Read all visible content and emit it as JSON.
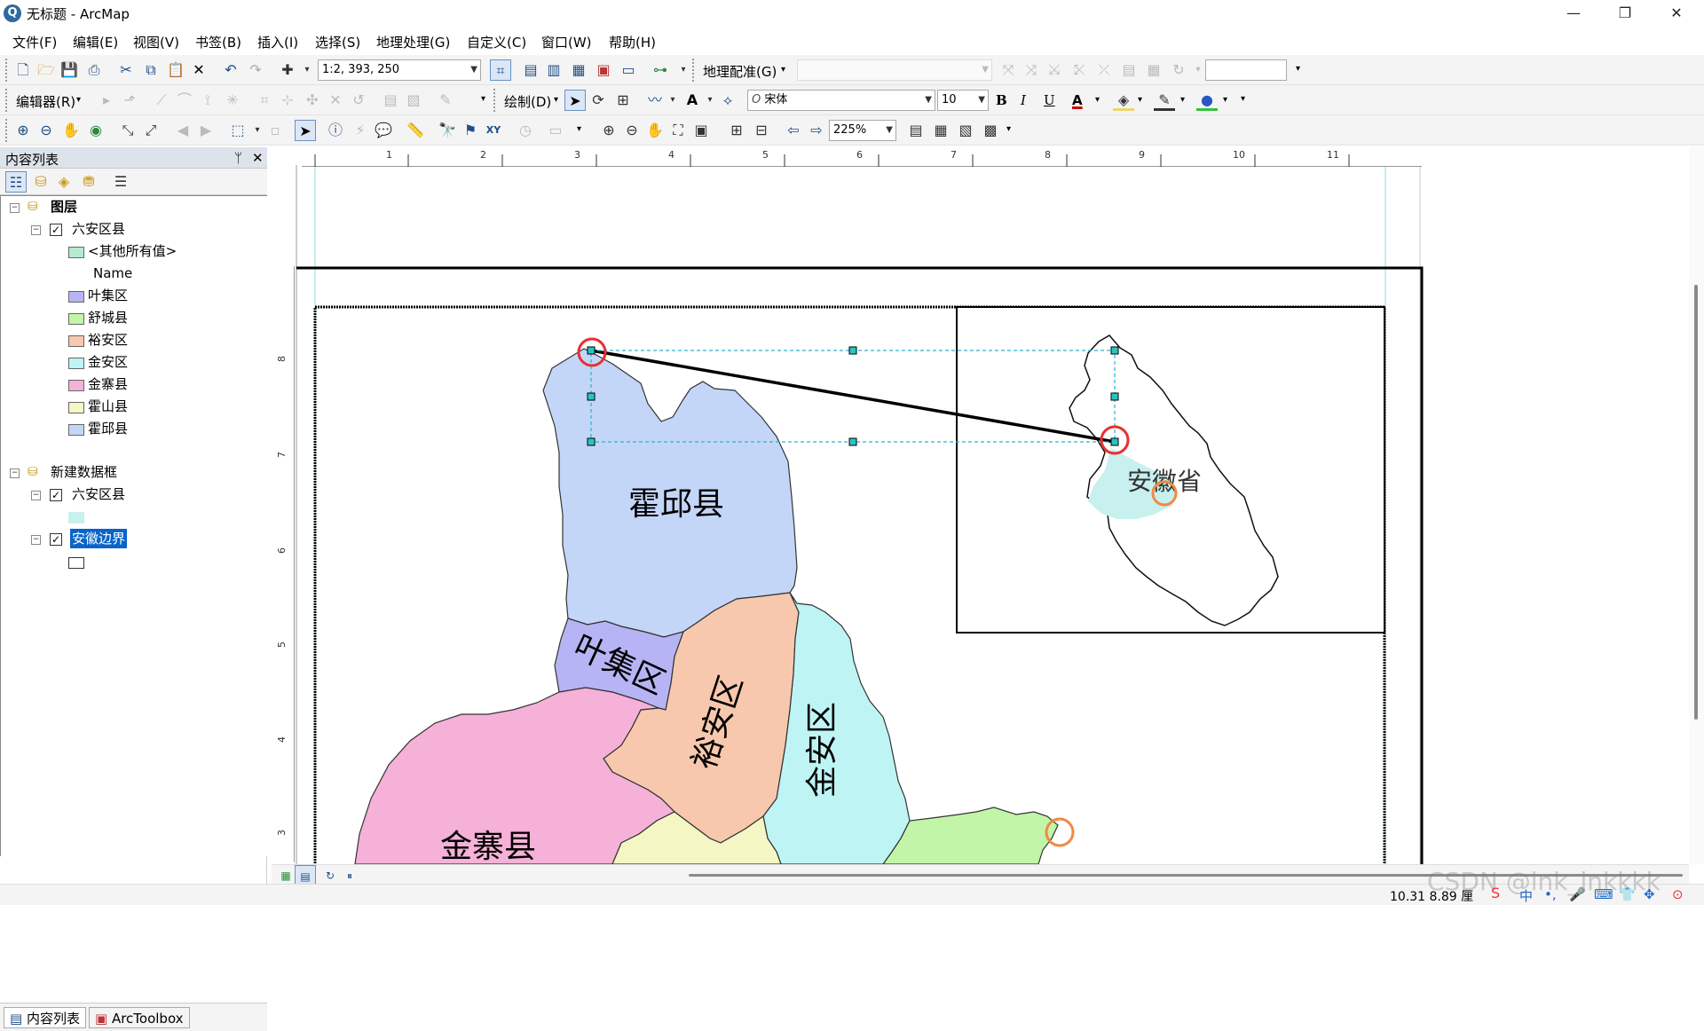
{
  "window": {
    "title": "无标题 - ArcMap",
    "minimize": "—",
    "maximize": "❐",
    "close": "✕"
  },
  "menu": [
    "文件(F)",
    "编辑(E)",
    "视图(V)",
    "书签(B)",
    "插入(I)",
    "选择(S)",
    "地理处理(G)",
    "自定义(C)",
    "窗口(W)",
    "帮助(H)"
  ],
  "toolbar1": {
    "scale": "1:2, 393, 250",
    "georef_label": "地理配准(G)"
  },
  "toolbar2": {
    "editor_label": "编辑器(R)",
    "draw_label": "绘制(D)",
    "font_name": "宋体",
    "font_size": "10",
    "bold": "B",
    "italic": "I",
    "underline": "U",
    "font_color": "A"
  },
  "toolbar3": {
    "zoom_level": "225%"
  },
  "toc": {
    "title": "内容列表",
    "pin": "ᛘ",
    "close": "✕",
    "frame1": {
      "name": "图层",
      "layer": {
        "name": "六安区县",
        "checked": true,
        "legend": [
          {
            "label": "<其他所有值>",
            "color": "#b4ebd0"
          },
          {
            "label": "Name",
            "color": ""
          },
          {
            "label": "叶集区",
            "color": "#b7b4f5"
          },
          {
            "label": "舒城县",
            "color": "#c2f5a8"
          },
          {
            "label": "裕安区",
            "color": "#f7c8ad"
          },
          {
            "label": "金安区",
            "color": "#bff4f5"
          },
          {
            "label": "金寨县",
            "color": "#f5b1d7"
          },
          {
            "label": "霍山县",
            "color": "#f4f6c4"
          },
          {
            "label": "霍邱县",
            "color": "#c4d6f7"
          }
        ]
      }
    },
    "frame2": {
      "name": "新建数据框",
      "layer1": {
        "name": "六安区县",
        "checked": true,
        "color": "#c8f0ef"
      },
      "layer2": {
        "name": "安徽边界",
        "checked": true,
        "color": "#ffffff"
      }
    },
    "tabs": [
      "内容列表",
      "ArcToolbox"
    ]
  },
  "ruler": {
    "h": [
      "1",
      "2",
      "3",
      "4",
      "5",
      "6",
      "7",
      "8",
      "9",
      "10",
      "11"
    ],
    "v": [
      "8",
      "7",
      "6",
      "5",
      "4",
      "3"
    ]
  },
  "map": {
    "counties": {
      "huoqiu": "霍邱县",
      "yeji": "叶集区",
      "yuan": "裕安区",
      "jinan": "金安区",
      "jinzhai": "金寨县"
    },
    "inset_label": "安徽省"
  },
  "status": {
    "coords": "10.31  8.89 厘",
    "watermark": "CSDN @ink_inkkkk"
  }
}
